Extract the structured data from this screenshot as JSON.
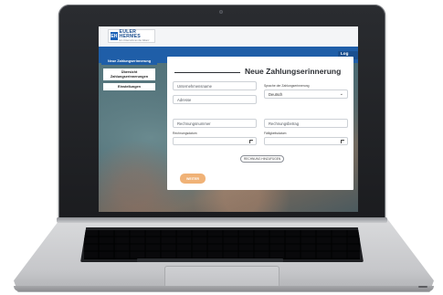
{
  "brand": {
    "mark": "EH",
    "name": "EULER HERMES",
    "tagline": "Ein Unternehmen der Allianz"
  },
  "header": {
    "logout_label": "Log out"
  },
  "sidebar": {
    "items": [
      {
        "label": "Neue Zahlungserinnerung"
      },
      {
        "label": "Übersicht Zahlungserinnerungen"
      },
      {
        "label": "Einstellungen"
      }
    ]
  },
  "form": {
    "title": "Neue Zahlungserinnerung",
    "company_placeholder": "Unternehmensname",
    "address_placeholder": "Adresse",
    "language_label": "Sprache der Zahlungserinnerung",
    "language_value": "Deutsch",
    "invoice_number_placeholder": "Rechnungsnummer",
    "invoice_amount_placeholder": "Rechnungsbetrag",
    "invoice_date_label": "Rechnungsdatum",
    "due_date_label": "Fälligkeitsdatum",
    "add_invoice_label": "RECHNUNG HINZUFÜGEN",
    "next_label": "WEITER"
  },
  "colors": {
    "brand_blue": "#1f5ea8",
    "accent_orange": "#f0b277",
    "laptop_silver": "#c6c7ca"
  }
}
